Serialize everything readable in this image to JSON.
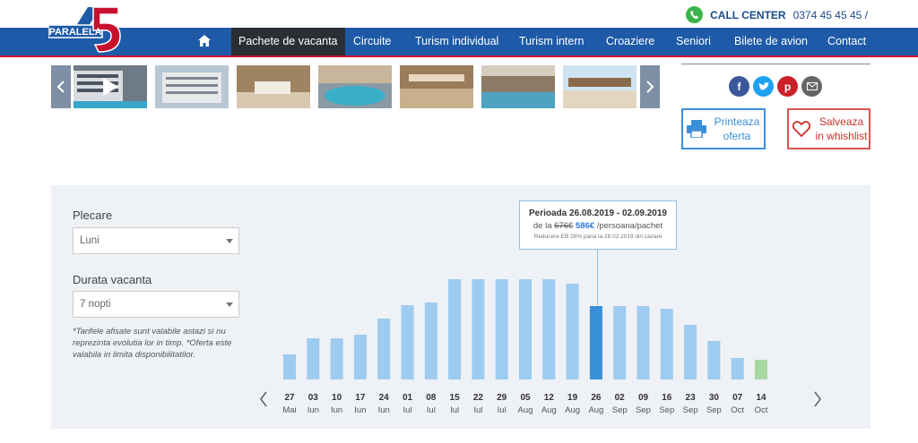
{
  "header": {
    "logo_number": "45",
    "logo_text": "PARALELA",
    "call_center_label": "CALL CENTER",
    "call_center_number": "0374 45 45 45 /"
  },
  "nav": {
    "items": [
      {
        "label": "Pachete de vacanta",
        "active": true
      },
      {
        "label": "Circuite"
      },
      {
        "label": "Turism individual"
      },
      {
        "label": "Turism intern"
      },
      {
        "label": "Croaziere"
      },
      {
        "label": "Seniori"
      },
      {
        "label": "Bilete de avion"
      },
      {
        "label": "Contact"
      }
    ]
  },
  "actions": {
    "print_label": "Printeaza oferta",
    "wishlist_label": "Salveaza in whishlist"
  },
  "filters": {
    "departure_label": "Plecare",
    "departure_value": "Luni",
    "duration_label": "Durata vacanta",
    "duration_value": "7 nopti",
    "note": "*Tarifele afisate sunt valabile astazi si nu reprezinta evolutia lor in timp. *Oferta este valabila in limita disponibilitatilor."
  },
  "tooltip": {
    "period": "Perioada 26.08.2019 - 02.09.2019",
    "price_prefix": "de la",
    "old_price": "676€",
    "new_price": "586€",
    "price_suffix": "/persoana/pachet",
    "discount_note": "Reducere EB 28% pana la 28.02.2019 din cazare"
  },
  "colors": {
    "nav_bg": "#1e5aa8",
    "accent_red": "#c8102e",
    "bar": "#9ecbf0",
    "bar_selected": "#3a8fd9",
    "bar_last": "#a8d8a0"
  },
  "chart_data": {
    "type": "bar",
    "categories": [
      "27 Mai",
      "03 Iun",
      "10 Iun",
      "17 Iun",
      "24 Iun",
      "01 Iul",
      "08 Iul",
      "15 Iul",
      "22 Iul",
      "29 Iul",
      "05 Aug",
      "12 Aug",
      "19 Aug",
      "26 Aug",
      "02 Sep",
      "09 Sep",
      "16 Sep",
      "23 Sep",
      "30 Sep",
      "07 Oct",
      "14 Oct"
    ],
    "days": [
      "27",
      "03",
      "10",
      "17",
      "24",
      "01",
      "08",
      "15",
      "22",
      "29",
      "05",
      "12",
      "19",
      "26",
      "02",
      "09",
      "16",
      "23",
      "30",
      "07",
      "14"
    ],
    "months": [
      "Mai",
      "Iun",
      "Iun",
      "Iun",
      "Iun",
      "Iul",
      "Iul",
      "Iul",
      "Iul",
      "Iul",
      "Aug",
      "Aug",
      "Aug",
      "Aug",
      "Sep",
      "Sep",
      "Sep",
      "Sep",
      "Sep",
      "Oct",
      "Oct"
    ],
    "values": [
      28,
      46,
      46,
      50,
      68,
      83,
      86,
      112,
      112,
      112,
      112,
      112,
      107,
      82,
      82,
      82,
      79,
      61,
      43,
      24,
      22
    ],
    "selected_index": 13,
    "highlight_last": true
  }
}
